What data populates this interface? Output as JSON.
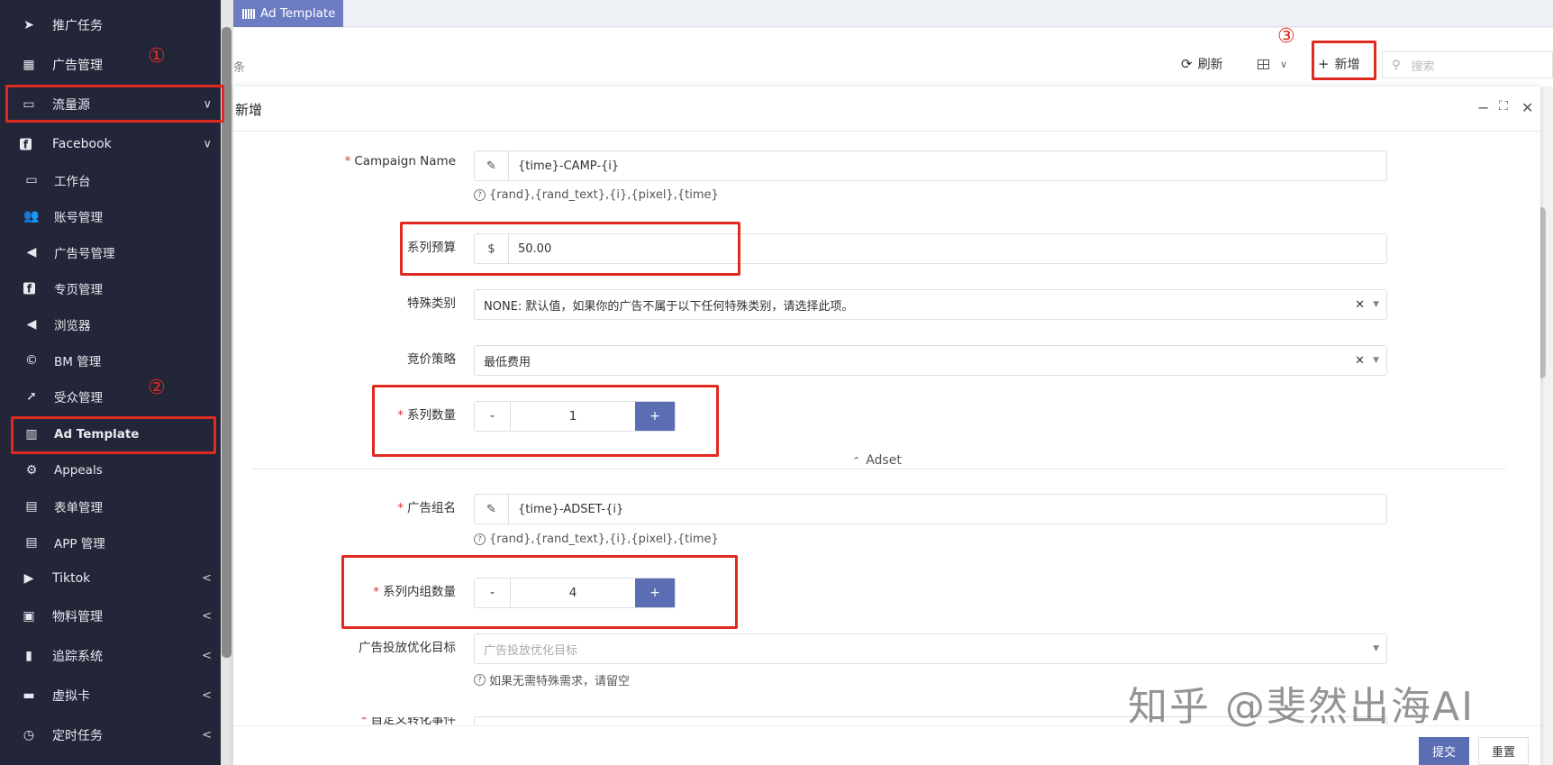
{
  "tab": {
    "label": "Ad Template"
  },
  "toolbar": {
    "crumb_fragment": "条",
    "refresh_label": "刷新",
    "add_label": "新增",
    "search_placeholder": "搜索",
    "marker3": "③"
  },
  "sidebar": {
    "items": [
      {
        "label": "推广任务",
        "icon": "send-icon"
      },
      {
        "label": "广告管理",
        "icon": "grid-icon",
        "marker": "①"
      },
      {
        "label": "流量源",
        "icon": "monitor-icon",
        "arrow": "∨"
      },
      {
        "label": "Facebook",
        "icon": "facebook-icon",
        "arrow": "∨"
      },
      {
        "label": "工作台",
        "icon": "monitor-icon"
      },
      {
        "label": "账号管理",
        "icon": "users-icon"
      },
      {
        "label": "广告号管理",
        "icon": "megaphone-icon"
      },
      {
        "label": "专页管理",
        "icon": "facebook-icon"
      },
      {
        "label": "浏览器",
        "icon": "megaphone-icon"
      },
      {
        "label": "BM 管理",
        "icon": "copyright-icon"
      },
      {
        "label": "受众管理",
        "icon": "location-arrow-icon",
        "marker": "②"
      },
      {
        "label": "Ad Template",
        "icon": "barcode-icon"
      },
      {
        "label": "Appeals",
        "icon": "gear-icon"
      },
      {
        "label": "表单管理",
        "icon": "file-icon"
      },
      {
        "label": "APP 管理",
        "icon": "file-icon"
      },
      {
        "label": "Tiktok",
        "icon": "play-circle-icon",
        "arrow": "<"
      },
      {
        "label": "物料管理",
        "icon": "archive-icon",
        "arrow": "<"
      },
      {
        "label": "追踪系统",
        "icon": "bar-chart-icon",
        "arrow": "<"
      },
      {
        "label": "虚拟卡",
        "icon": "credit-card-icon",
        "arrow": "<"
      },
      {
        "label": "定时任务",
        "icon": "clock-icon",
        "arrow": "<"
      }
    ]
  },
  "modal": {
    "title": "新增",
    "campaign_name": {
      "label": "Campaign Name",
      "value": "{time}-CAMP-{i}",
      "hint": "{rand},{rand_text},{i},{pixel},{time}"
    },
    "budget": {
      "label": "系列预算",
      "prefix": "$",
      "value": "50.00"
    },
    "special_category": {
      "label": "特殊类别",
      "value": "NONE: 默认值，如果你的广告不属于以下任何特殊类别，请选择此项。"
    },
    "bid_strategy": {
      "label": "竞价策略",
      "value": "最低费用"
    },
    "campaign_count": {
      "label": "系列数量",
      "value": "1"
    },
    "section_adset": "Adset",
    "adset_name": {
      "label": "广告组名",
      "value": "{time}-ADSET-{i}",
      "hint": "{rand},{rand_text},{i},{pixel},{time}"
    },
    "adset_count": {
      "label": "系列内组数量",
      "value": "4"
    },
    "optimization_goal": {
      "label": "广告投放优化目标",
      "placeholder": "广告投放优化目标",
      "hint": "如果无需特殊需求，请留空"
    },
    "custom_event_label": "自定义转化事件",
    "submit_label": "提交",
    "reset_label": "重置"
  },
  "watermark": "知乎 @斐然出海AI",
  "colors": {
    "sidebar_bg": "#232638",
    "accent": "#5b6db3",
    "annotation_red": "#e02a20"
  }
}
